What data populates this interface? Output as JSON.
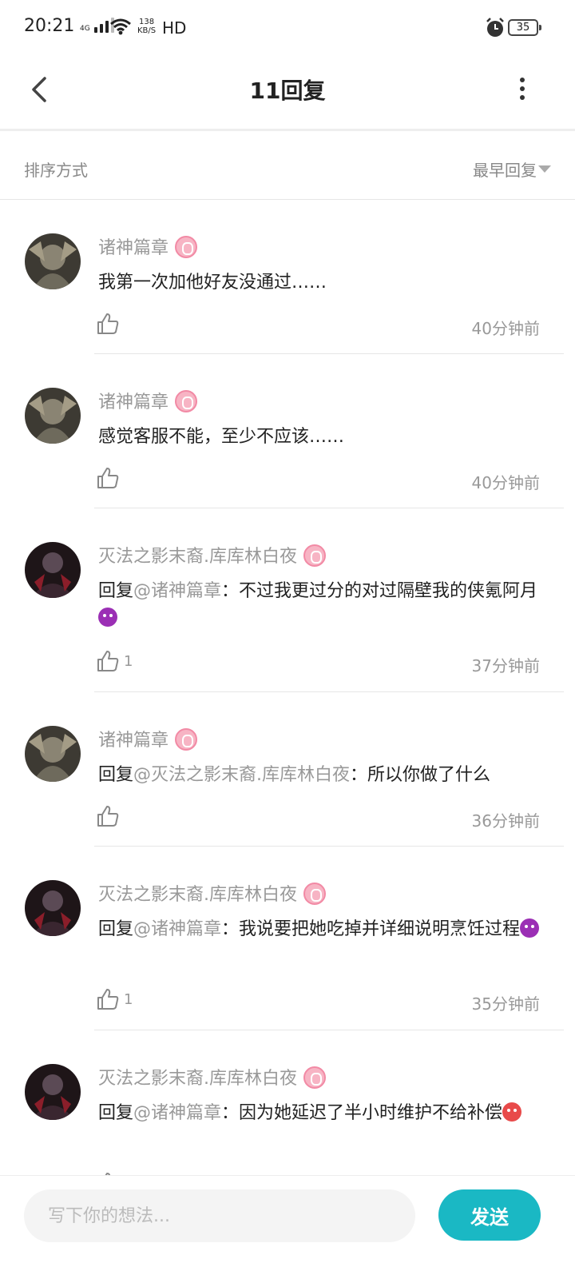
{
  "status_bar": {
    "time": "20:21",
    "network": "4G",
    "speed_value": "138",
    "speed_unit": "KB/S",
    "hd": "HD",
    "battery": "35"
  },
  "header": {
    "title": "11回复",
    "back_icon": "chevron-left-icon",
    "more_icon": "more-vertical-icon"
  },
  "sort": {
    "label": "排序方式",
    "value": "最早回复"
  },
  "comments": [
    {
      "user": "诸神篇章",
      "avatar": "gray-artwork",
      "prefix": "",
      "mention": "",
      "text": "我第一次加他好友没通过……",
      "emoji": "",
      "likes": "",
      "time": "40分钟前"
    },
    {
      "user": "诸神篇章",
      "avatar": "gray-artwork",
      "prefix": "",
      "mention": "",
      "text": "感觉客服不能，至少不应该……",
      "emoji": "",
      "likes": "",
      "time": "40分钟前"
    },
    {
      "user": "灭法之影末裔.库库林白夜",
      "avatar": "dark-red-character",
      "prefix": "回复",
      "mention": "@诸神篇章",
      "text": "：不过我更过分的对过隔壁我的侠氪阿月",
      "emoji": "devil",
      "likes": "1",
      "time": "37分钟前"
    },
    {
      "user": "诸神篇章",
      "avatar": "gray-artwork",
      "prefix": "回复",
      "mention": "@灭法之影末裔.库库林白夜",
      "text": "：所以你做了什么",
      "emoji": "",
      "likes": "",
      "time": "36分钟前"
    },
    {
      "user": "灭法之影末裔.库库林白夜",
      "avatar": "dark-red-character",
      "prefix": "回复",
      "mention": "@诸神篇章",
      "text": "：我说要把她吃掉并详细说明烹饪过程",
      "emoji": "devil",
      "likes": "1",
      "time": "35分钟前"
    },
    {
      "user": "灭法之影末裔.库库林白夜",
      "avatar": "dark-red-character",
      "prefix": "回复",
      "mention": "@诸神篇章",
      "text": "：因为她延迟了半小时维护不给补偿",
      "emoji": "angry",
      "likes": "",
      "time": ""
    }
  ],
  "composer": {
    "placeholder": "写下你的想法...",
    "send_label": "发送"
  },
  "colors": {
    "accent": "#1ab8c4",
    "badge": "#f7b4c4",
    "muted_text": "#999999"
  }
}
